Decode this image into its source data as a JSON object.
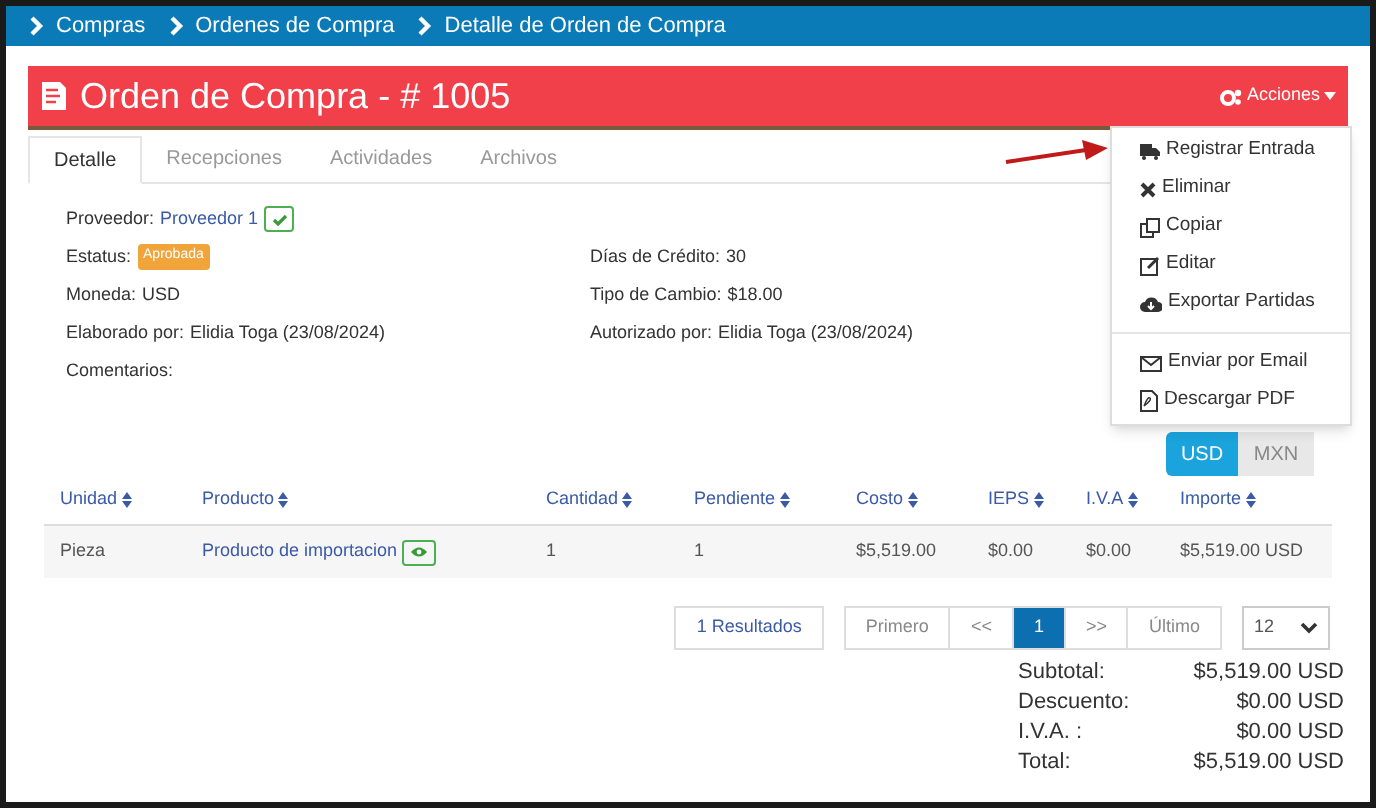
{
  "breadcrumb": [
    "Compras",
    "Ordenes de Compra",
    "Detalle de Orden de Compra"
  ],
  "header": {
    "title": "Orden de Compra - # 1005",
    "actions": "Acciones"
  },
  "tabs": [
    {
      "label": "Detalle",
      "selected": true
    },
    {
      "label": "Recepciones",
      "selected": false
    },
    {
      "label": "Actividades",
      "selected": false
    },
    {
      "label": "Archivos",
      "selected": false
    }
  ],
  "details_left": [
    {
      "label": "Proveedor:",
      "value": "Proveedor 1",
      "kind": "link"
    },
    {
      "label": "Estatus:",
      "value": "Aprobada",
      "kind": "badge"
    },
    {
      "label": "Moneda:",
      "value": "USD",
      "kind": "text"
    },
    {
      "label": "Elaborado por:",
      "value": "Elidia Toga (23/08/2024)",
      "kind": "text"
    },
    {
      "label": "Comentarios:"
    }
  ],
  "details_right": [
    {
      "label": "Días de Crédito:",
      "value": "30"
    },
    {
      "label": "Tipo de Cambio:",
      "value": "$18.00"
    },
    {
      "label": "Autorizado por:",
      "value": "Elidia Toga (23/08/2024)"
    }
  ],
  "currency_toggle": [
    {
      "label": "USD",
      "selected": true
    },
    {
      "label": "MXN",
      "selected": false
    }
  ],
  "table": {
    "columns": [
      "Unidad",
      "Producto",
      "Cantidad",
      "Pendiente",
      "Costo",
      "IEPS",
      "I.V.A",
      "Importe"
    ],
    "rows": [
      [
        "Pieza",
        "Producto de importacion",
        "1",
        "1",
        "$5,519.00",
        "$0.00",
        "$0.00",
        "$5,519.00 USD"
      ]
    ]
  },
  "pagination": {
    "results": "1 Resultados",
    "pages": [
      {
        "label": "Primero",
        "selected": false
      },
      {
        "label": "<<",
        "selected": false
      },
      {
        "label": "1",
        "selected": true
      },
      {
        "label": ">>",
        "selected": false
      },
      {
        "label": "Último",
        "selected": false
      }
    ],
    "page_size": "12"
  },
  "totals": [
    {
      "label": "Subtotal:",
      "value": "$5,519.00 USD"
    },
    {
      "label": "Descuento:",
      "value": "$0.00 USD"
    },
    {
      "label": "I.V.A. :",
      "value": "$0.00 USD"
    },
    {
      "label": "Total:",
      "value": "$5,519.00 USD"
    }
  ],
  "actions_menu": [
    {
      "label": "Registrar Entrada",
      "kind": "truck"
    },
    {
      "label": "Eliminar",
      "kind": "delete"
    },
    {
      "label": "Copiar",
      "kind": "copy"
    },
    {
      "label": "Editar",
      "kind": "edit"
    },
    {
      "label": "Exportar Partidas",
      "kind": "cloud"
    },
    {
      "kind": "divider"
    },
    {
      "label": "Enviar por Email",
      "kind": "mail"
    },
    {
      "label": "Descargar PDF",
      "kind": "pdf"
    }
  ]
}
